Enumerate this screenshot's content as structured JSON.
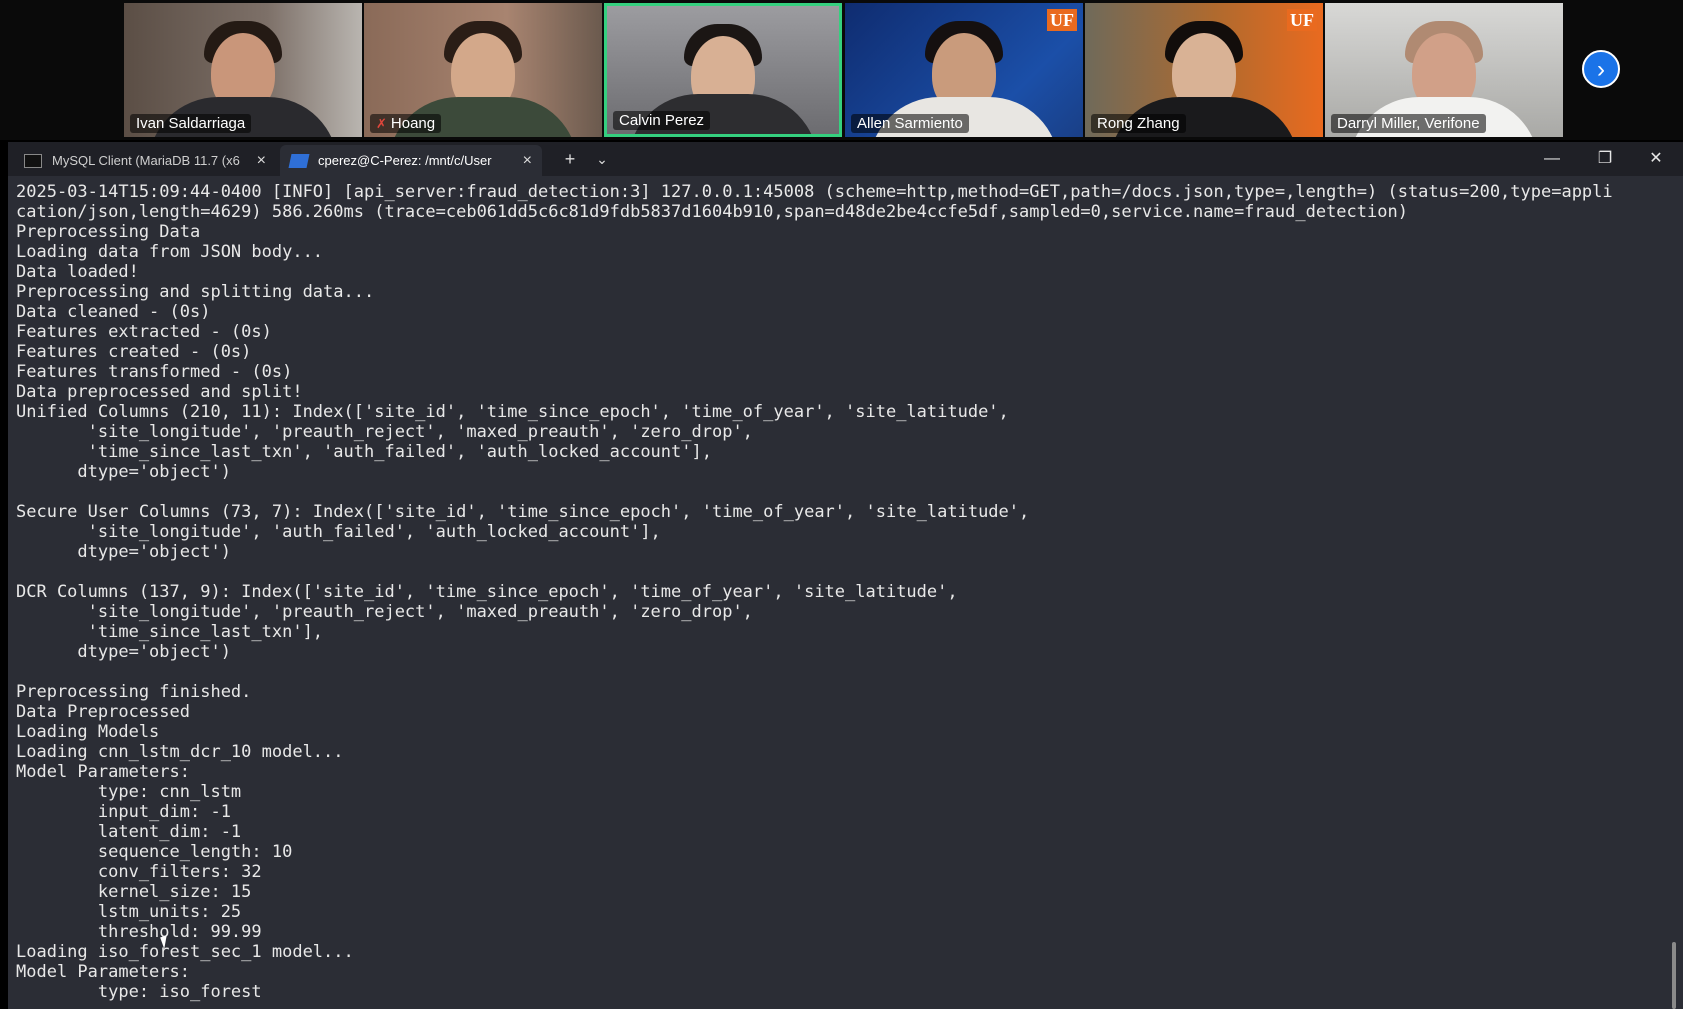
{
  "meeting": {
    "participants": [
      {
        "name": "Ivan Saldarriaga",
        "muted": false,
        "active": false
      },
      {
        "name": "Hoang",
        "muted": true,
        "active": false
      },
      {
        "name": "Calvin Perez",
        "muted": false,
        "active": true
      },
      {
        "name": "Allen Sarmiento",
        "muted": false,
        "active": false
      },
      {
        "name": "Rong Zhang",
        "muted": false,
        "active": false
      },
      {
        "name": "Darryl Miller, Verifone",
        "muted": false,
        "active": false
      }
    ],
    "badge_text": "UF",
    "next_icon": "chevron-right-icon",
    "colors": {
      "active_border": "#35d07f",
      "next_button": "#1a73e8",
      "uf_orange": "#e96a1f"
    }
  },
  "terminal_window": {
    "tabs": [
      {
        "label": "MySQL Client (MariaDB 11.7 (x6",
        "icon": "cmd-icon",
        "active": false
      },
      {
        "label": "cperez@C-Perez: /mnt/c/User",
        "icon": "powershell-icon",
        "active": true
      }
    ],
    "new_tab": "+",
    "dropdown": "⌄",
    "controls": {
      "minimize": "—",
      "restore": "❐",
      "close": "✕"
    }
  },
  "terminal": {
    "lines": [
      "2025-03-14T15:09:44-0400 [INFO] [api_server:fraud_detection:3] 127.0.0.1:45008 (scheme=http,method=GET,path=/docs.json,type=,length=) (status=200,type=appli",
      "cation/json,length=4629) 586.260ms (trace=ceb061dd5c6c81d9fdb5837d1604b910,span=d48de2be4ccfe5df,sampled=0,service.name=fraud_detection)",
      "Preprocessing Data",
      "Loading data from JSON body...",
      "Data loaded!",
      "Preprocessing and splitting data...",
      "Data cleaned - (0s)",
      "Features extracted - (0s)",
      "Features created - (0s)",
      "Features transformed - (0s)",
      "Data preprocessed and split!",
      "Unified Columns (210, 11): Index(['site_id', 'time_since_epoch', 'time_of_year', 'site_latitude',",
      "       'site_longitude', 'preauth_reject', 'maxed_preauth', 'zero_drop',",
      "       'time_since_last_txn', 'auth_failed', 'auth_locked_account'],",
      "      dtype='object')",
      "",
      "Secure User Columns (73, 7): Index(['site_id', 'time_since_epoch', 'time_of_year', 'site_latitude',",
      "       'site_longitude', 'auth_failed', 'auth_locked_account'],",
      "      dtype='object')",
      "",
      "DCR Columns (137, 9): Index(['site_id', 'time_since_epoch', 'time_of_year', 'site_latitude',",
      "       'site_longitude', 'preauth_reject', 'maxed_preauth', 'zero_drop',",
      "       'time_since_last_txn'],",
      "      dtype='object')",
      "",
      "Preprocessing finished.",
      "Data Preprocessed",
      "Loading Models",
      "Loading cnn_lstm_dcr_10 model...",
      "Model Parameters:",
      "        type: cnn_lstm",
      "        input_dim: -1",
      "        latent_dim: -1",
      "        sequence_length: 10",
      "        conv_filters: 32",
      "        kernel_size: 15",
      "        lstm_units: 25",
      "        threshold: 99.99",
      "Loading iso_forest_sec_1 model...",
      "Model Parameters:",
      "        type: iso_forest"
    ],
    "colors": {
      "background": "#2b2d35",
      "foreground": "#e8e8e8"
    }
  }
}
